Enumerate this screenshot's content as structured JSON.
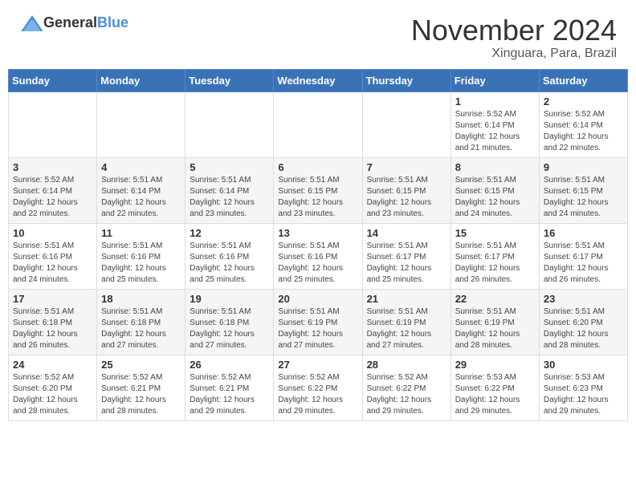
{
  "header": {
    "logo": {
      "general": "General",
      "blue": "Blue"
    },
    "title": "November 2024",
    "location": "Xinguara, Para, Brazil"
  },
  "calendar": {
    "days_of_week": [
      "Sunday",
      "Monday",
      "Tuesday",
      "Wednesday",
      "Thursday",
      "Friday",
      "Saturday"
    ],
    "weeks": [
      [
        {
          "day": "",
          "info": ""
        },
        {
          "day": "",
          "info": ""
        },
        {
          "day": "",
          "info": ""
        },
        {
          "day": "",
          "info": ""
        },
        {
          "day": "",
          "info": ""
        },
        {
          "day": "1",
          "info": "Sunrise: 5:52 AM\nSunset: 6:14 PM\nDaylight: 12 hours\nand 21 minutes."
        },
        {
          "day": "2",
          "info": "Sunrise: 5:52 AM\nSunset: 6:14 PM\nDaylight: 12 hours\nand 22 minutes."
        }
      ],
      [
        {
          "day": "3",
          "info": "Sunrise: 5:52 AM\nSunset: 6:14 PM\nDaylight: 12 hours\nand 22 minutes."
        },
        {
          "day": "4",
          "info": "Sunrise: 5:51 AM\nSunset: 6:14 PM\nDaylight: 12 hours\nand 22 minutes."
        },
        {
          "day": "5",
          "info": "Sunrise: 5:51 AM\nSunset: 6:14 PM\nDaylight: 12 hours\nand 23 minutes."
        },
        {
          "day": "6",
          "info": "Sunrise: 5:51 AM\nSunset: 6:15 PM\nDaylight: 12 hours\nand 23 minutes."
        },
        {
          "day": "7",
          "info": "Sunrise: 5:51 AM\nSunset: 6:15 PM\nDaylight: 12 hours\nand 23 minutes."
        },
        {
          "day": "8",
          "info": "Sunrise: 5:51 AM\nSunset: 6:15 PM\nDaylight: 12 hours\nand 24 minutes."
        },
        {
          "day": "9",
          "info": "Sunrise: 5:51 AM\nSunset: 6:15 PM\nDaylight: 12 hours\nand 24 minutes."
        }
      ],
      [
        {
          "day": "10",
          "info": "Sunrise: 5:51 AM\nSunset: 6:16 PM\nDaylight: 12 hours\nand 24 minutes."
        },
        {
          "day": "11",
          "info": "Sunrise: 5:51 AM\nSunset: 6:16 PM\nDaylight: 12 hours\nand 25 minutes."
        },
        {
          "day": "12",
          "info": "Sunrise: 5:51 AM\nSunset: 6:16 PM\nDaylight: 12 hours\nand 25 minutes."
        },
        {
          "day": "13",
          "info": "Sunrise: 5:51 AM\nSunset: 6:16 PM\nDaylight: 12 hours\nand 25 minutes."
        },
        {
          "day": "14",
          "info": "Sunrise: 5:51 AM\nSunset: 6:17 PM\nDaylight: 12 hours\nand 25 minutes."
        },
        {
          "day": "15",
          "info": "Sunrise: 5:51 AM\nSunset: 6:17 PM\nDaylight: 12 hours\nand 26 minutes."
        },
        {
          "day": "16",
          "info": "Sunrise: 5:51 AM\nSunset: 6:17 PM\nDaylight: 12 hours\nand 26 minutes."
        }
      ],
      [
        {
          "day": "17",
          "info": "Sunrise: 5:51 AM\nSunset: 6:18 PM\nDaylight: 12 hours\nand 26 minutes."
        },
        {
          "day": "18",
          "info": "Sunrise: 5:51 AM\nSunset: 6:18 PM\nDaylight: 12 hours\nand 27 minutes."
        },
        {
          "day": "19",
          "info": "Sunrise: 5:51 AM\nSunset: 6:18 PM\nDaylight: 12 hours\nand 27 minutes."
        },
        {
          "day": "20",
          "info": "Sunrise: 5:51 AM\nSunset: 6:19 PM\nDaylight: 12 hours\nand 27 minutes."
        },
        {
          "day": "21",
          "info": "Sunrise: 5:51 AM\nSunset: 6:19 PM\nDaylight: 12 hours\nand 27 minutes."
        },
        {
          "day": "22",
          "info": "Sunrise: 5:51 AM\nSunset: 6:19 PM\nDaylight: 12 hours\nand 28 minutes."
        },
        {
          "day": "23",
          "info": "Sunrise: 5:51 AM\nSunset: 6:20 PM\nDaylight: 12 hours\nand 28 minutes."
        }
      ],
      [
        {
          "day": "24",
          "info": "Sunrise: 5:52 AM\nSunset: 6:20 PM\nDaylight: 12 hours\nand 28 minutes."
        },
        {
          "day": "25",
          "info": "Sunrise: 5:52 AM\nSunset: 6:21 PM\nDaylight: 12 hours\nand 28 minutes."
        },
        {
          "day": "26",
          "info": "Sunrise: 5:52 AM\nSunset: 6:21 PM\nDaylight: 12 hours\nand 29 minutes."
        },
        {
          "day": "27",
          "info": "Sunrise: 5:52 AM\nSunset: 6:22 PM\nDaylight: 12 hours\nand 29 minutes."
        },
        {
          "day": "28",
          "info": "Sunrise: 5:52 AM\nSunset: 6:22 PM\nDaylight: 12 hours\nand 29 minutes."
        },
        {
          "day": "29",
          "info": "Sunrise: 5:53 AM\nSunset: 6:22 PM\nDaylight: 12 hours\nand 29 minutes."
        },
        {
          "day": "30",
          "info": "Sunrise: 5:53 AM\nSunset: 6:23 PM\nDaylight: 12 hours\nand 29 minutes."
        }
      ]
    ]
  }
}
